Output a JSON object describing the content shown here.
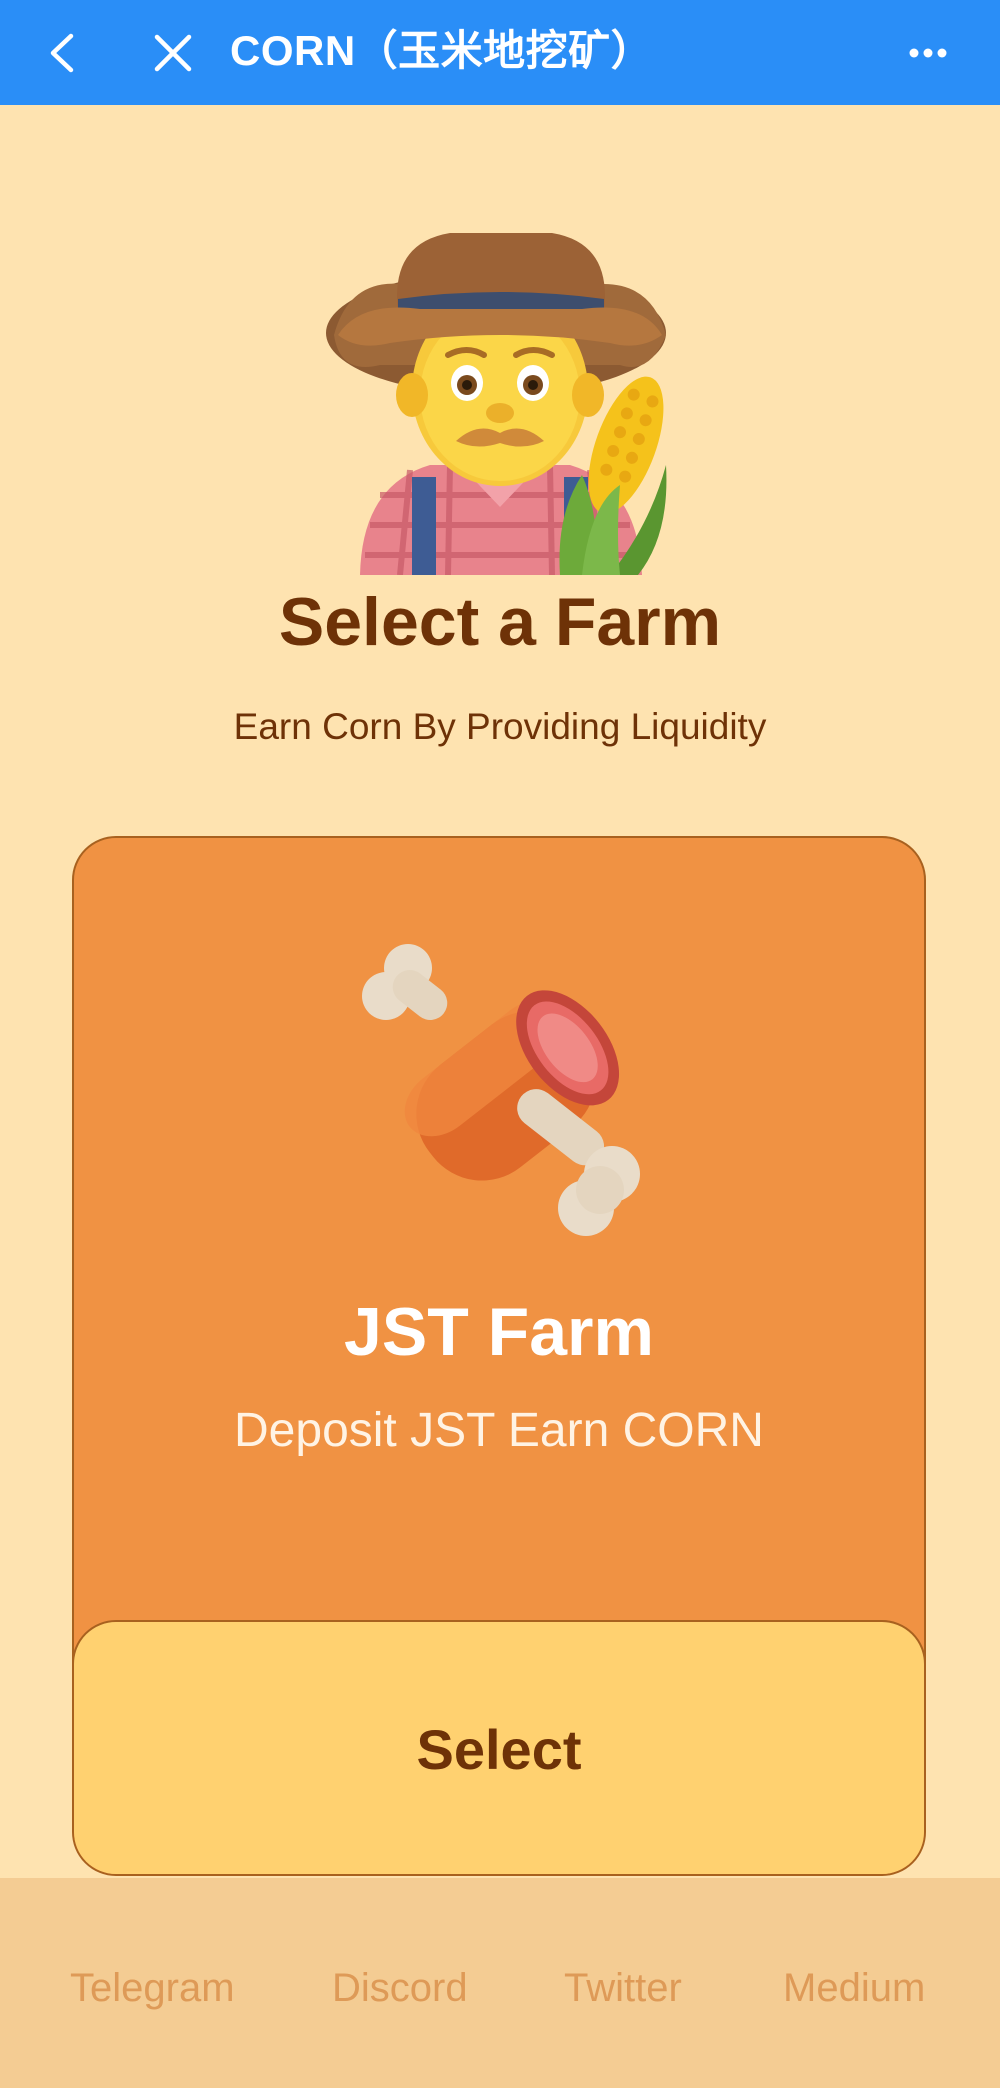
{
  "nav": {
    "title": "CORN（玉米地挖矿）",
    "back_icon": "chevron-left-icon",
    "close_icon": "close-icon",
    "more_icon": "more-dots-icon"
  },
  "hero": {
    "illustration": "farmer-emoji",
    "title": "Select a Farm",
    "subtitle": "Earn Corn By Providing Liquidity"
  },
  "farm": {
    "icon": "meat-on-bone-emoji",
    "name": "JST Farm",
    "description": "Deposit JST Earn CORN",
    "select_label": "Select"
  },
  "footer": {
    "links": [
      "Telegram",
      "Discord",
      "Twitter",
      "Medium"
    ]
  },
  "colors": {
    "nav_bg": "#2A8EF7",
    "page_bg": "#FEE3B0",
    "card_bg": "#F09243",
    "button_bg": "#FFD170",
    "text_brown": "#6E3207",
    "footer_bg": "#F4CC93",
    "footer_text": "#DE9A57"
  }
}
